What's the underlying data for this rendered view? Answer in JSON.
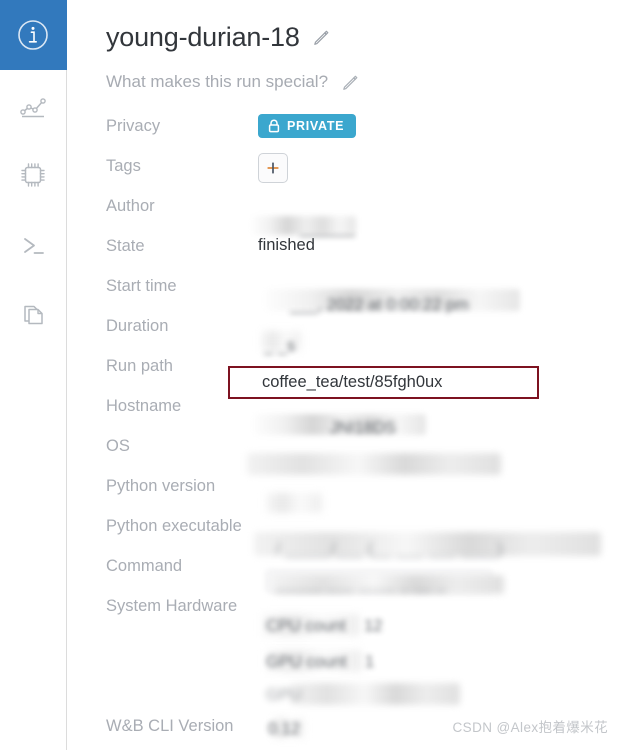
{
  "sidebar": {
    "items": [
      {
        "name": "overview",
        "icon": "info-circle-icon",
        "active": true
      },
      {
        "name": "charts",
        "icon": "line-chart-icon",
        "active": false
      },
      {
        "name": "system",
        "icon": "cpu-chip-icon",
        "active": false
      },
      {
        "name": "logs",
        "icon": "terminal-icon",
        "active": false
      },
      {
        "name": "files",
        "icon": "files-copy-icon",
        "active": false
      }
    ],
    "active_color": "#3279bd"
  },
  "header": {
    "title": "young-durian-18",
    "edit_icon": "pencil-icon",
    "description_placeholder": "What makes this run special?",
    "description_edit_icon": "pencil-icon"
  },
  "overview": {
    "rows": [
      {
        "key": "Privacy",
        "value": "",
        "redacted": false
      },
      {
        "key": "Tags",
        "value": "",
        "redacted": false
      },
      {
        "key": "Author",
        "value": "",
        "redacted": true
      },
      {
        "key": "State",
        "value": "finished",
        "redacted": false
      },
      {
        "key": "Start time",
        "value": "",
        "redacted": true
      },
      {
        "key": "Duration",
        "value": "",
        "redacted": true
      },
      {
        "key": "Run path",
        "value": "coffee_tea/test/85fgh0ux",
        "redacted": false
      },
      {
        "key": "Hostname",
        "value": "",
        "redacted": true
      },
      {
        "key": "OS",
        "value": "",
        "redacted": true
      },
      {
        "key": "Python version",
        "value": "",
        "redacted": true
      },
      {
        "key": "Python executable",
        "value": "",
        "redacted": true
      },
      {
        "key": "Command",
        "value": "",
        "redacted": true
      },
      {
        "key": "System Hardware",
        "value": "",
        "redacted": true
      },
      {
        "key": "W&B CLI Version",
        "value": "",
        "redacted": true
      }
    ],
    "privacy_badge": {
      "label": "PRIVATE",
      "icon": "lock-icon",
      "color": "#3ba7ce"
    },
    "tags_add_button": {
      "label": "+",
      "icon": "plus-icon"
    },
    "state_value": "finished",
    "run_path_value": "coffee_tea/test/85fgh0ux",
    "run_path_highlight_color": "#7d1220"
  },
  "watermark": {
    "text": "CSDN @Alex抱着爆米花"
  }
}
